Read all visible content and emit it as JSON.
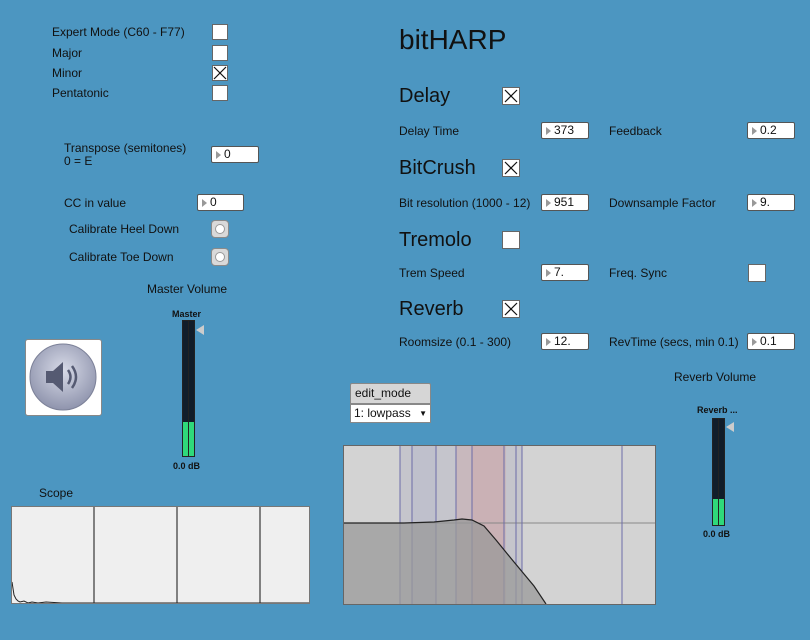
{
  "modes": {
    "expert_label": "Expert Mode (C60 - F77)",
    "major_label": "Major",
    "minor_label": "Minor",
    "pentatonic_label": "Pentatonic",
    "expert_checked": false,
    "major_checked": false,
    "minor_checked": true,
    "pentatonic_checked": false
  },
  "transpose": {
    "label_line1": "Transpose (semitones)",
    "label_line2": "0 = E",
    "value": "0"
  },
  "cc": {
    "label": "CC in value",
    "value": "0"
  },
  "calibrate": {
    "heel_label": "Calibrate Heel Down",
    "toe_label": "Calibrate Toe Down"
  },
  "master": {
    "section_label": "Master Volume",
    "meter_label": "Master",
    "db": "0.0 dB",
    "icon": "speaker-icon",
    "level": 0.25
  },
  "scope": {
    "label": "Scope"
  },
  "app": {
    "title": "bitHARP"
  },
  "delay": {
    "title": "Delay",
    "enabled": true,
    "time_label": "Delay Time",
    "time_value": "373",
    "feedback_label": "Feedback",
    "feedback_value": "0.2"
  },
  "bitcrush": {
    "title": "BitCrush",
    "enabled": true,
    "res_label": "Bit resolution (1000 - 12)",
    "res_value": "951",
    "downsample_label": "Downsample Factor",
    "downsample_value": "9."
  },
  "tremolo": {
    "title": "Tremolo",
    "enabled": false,
    "speed_label": "Trem Speed",
    "speed_value": "7.",
    "sync_label": "Freq. Sync",
    "sync_checked": false
  },
  "reverb": {
    "title": "Reverb",
    "enabled": true,
    "roomsize_label": "Roomsize (0.1 - 300)",
    "roomsize_value": "12.",
    "revtime_label": "RevTime (secs, min 0.1)",
    "revtime_value": "0.1",
    "volume_label": "Reverb Volume",
    "meter_label": "Reverb ...",
    "db": "0.0 dB",
    "level": 0.25
  },
  "filter": {
    "mode_label": "edit_mode",
    "mode_value": "1: lowpass"
  },
  "colors": {
    "background": "#4c96c1",
    "meter_green": "#2fd97a"
  }
}
